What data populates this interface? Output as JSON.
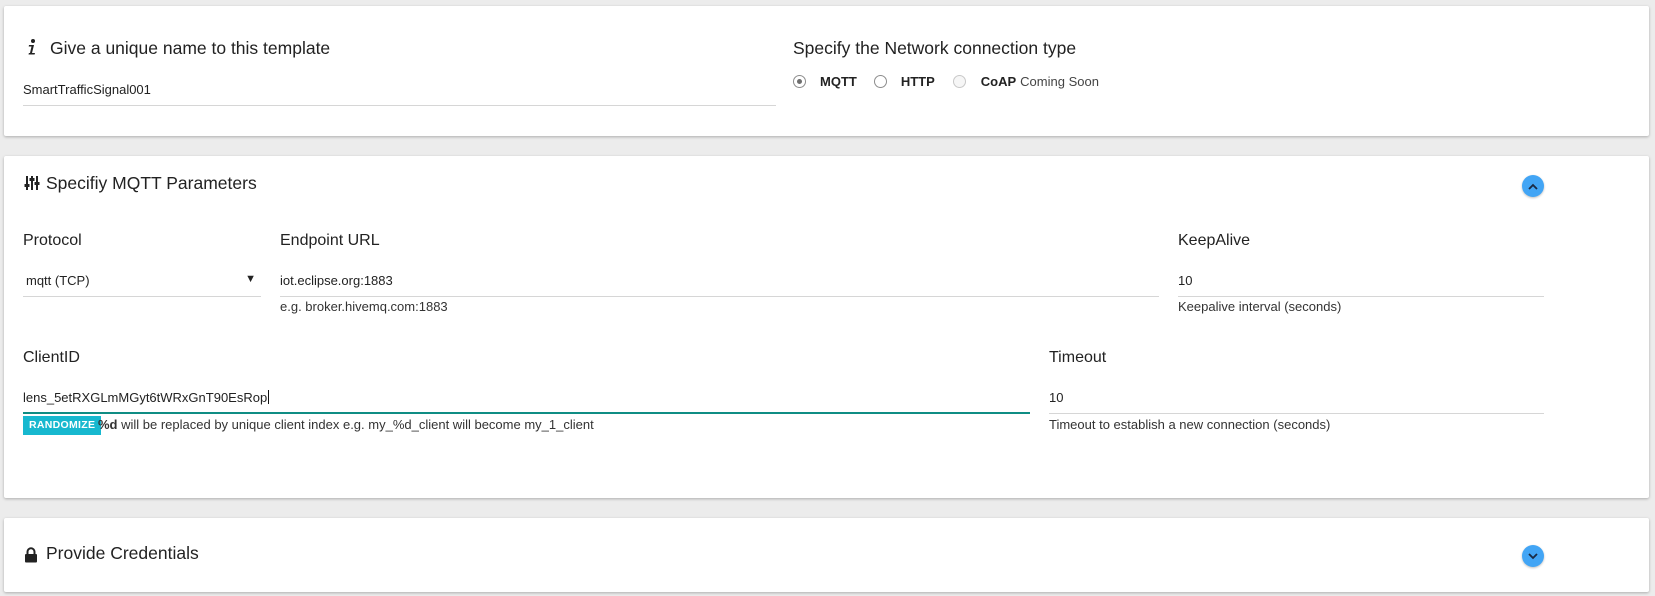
{
  "template": {
    "heading": "Give a unique name to this template",
    "name_value": "SmartTrafficSignal001"
  },
  "network": {
    "heading": "Specify the Network connection type",
    "options": [
      {
        "label": "MQTT",
        "suffix": "",
        "checked": true,
        "disabled": false
      },
      {
        "label": "HTTP",
        "suffix": "",
        "checked": false,
        "disabled": false
      },
      {
        "label": "CoAP",
        "suffix": "Coming Soon",
        "checked": false,
        "disabled": true
      }
    ]
  },
  "mqtt": {
    "heading": "Specifiy MQTT Parameters",
    "protocol": {
      "label": "Protocol",
      "value": "mqtt (TCP)"
    },
    "endpoint": {
      "label": "Endpoint URL",
      "value": "iot.eclipse.org:1883",
      "hint": "e.g. broker.hivemq.com:1883"
    },
    "keepalive": {
      "label": "KeepAlive",
      "value": "10",
      "hint": "Keepalive interval (seconds)"
    },
    "clientid": {
      "label": "ClientID",
      "value": "lens_5etRXGLmMGyt6tWRxGnT90EsRop",
      "randomize_label": "RANDOMIZE",
      "hint_bold": "%d",
      "hint_rest": " will be replaced by unique client index e.g. my_%d_client will become my_1_client"
    },
    "timeout": {
      "label": "Timeout",
      "value": "10",
      "hint": "Timeout to establish a new connection (seconds)"
    }
  },
  "credentials": {
    "heading": "Provide Credentials"
  },
  "colors": {
    "accent_blue": "#42a5f5",
    "randomize_teal": "#17b8cf",
    "active_underline": "#0f8d84"
  }
}
